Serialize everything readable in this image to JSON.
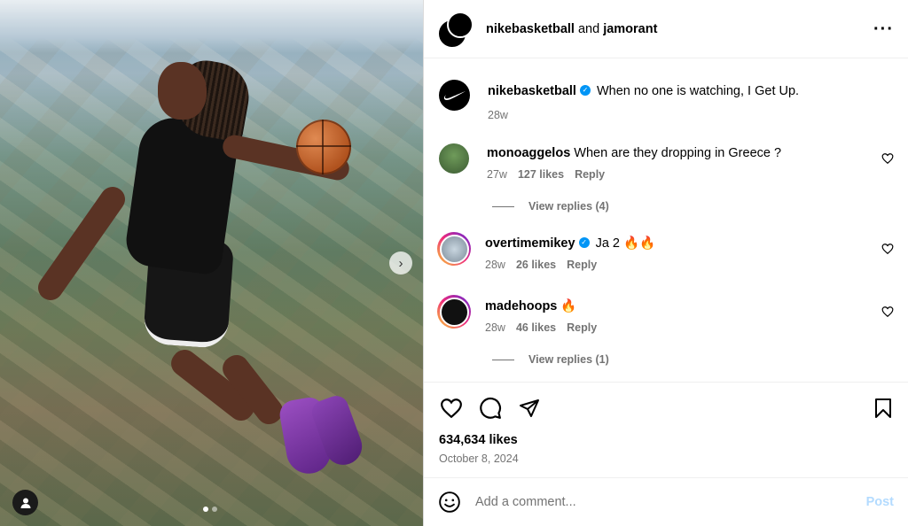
{
  "header": {
    "author": "nikebasketball",
    "joiner": " and ",
    "coauthor": "jamorant",
    "more_icon": "more-horizontal-icon"
  },
  "caption": {
    "username": "nikebasketball",
    "text": "When no one is watching, I Get Up.",
    "age": "28w"
  },
  "comments": [
    {
      "username": "monoaggelos",
      "text": "When are they dropping in Greece ?",
      "age": "27w",
      "likes": "127 likes",
      "reply": "Reply",
      "view_replies": "View replies (4)",
      "verified": false
    },
    {
      "username": "overtimemikey",
      "text": "Ja 2 🔥🔥",
      "age": "28w",
      "likes": "26 likes",
      "reply": "Reply",
      "verified": true
    },
    {
      "username": "madehoops",
      "text": "🔥",
      "age": "28w",
      "likes": "46 likes",
      "reply": "Reply",
      "view_replies": "View replies (1)",
      "verified": false
    }
  ],
  "stats": {
    "likes": "634,634 likes",
    "date": "October 8, 2024"
  },
  "composer": {
    "placeholder": "Add a comment...",
    "post_label": "Post"
  },
  "media": {
    "slide_count": 2,
    "active_slide": 1
  },
  "colors": {
    "verified": "#0095f6",
    "post_disabled": "#b3dbff",
    "meta": "#737373"
  }
}
